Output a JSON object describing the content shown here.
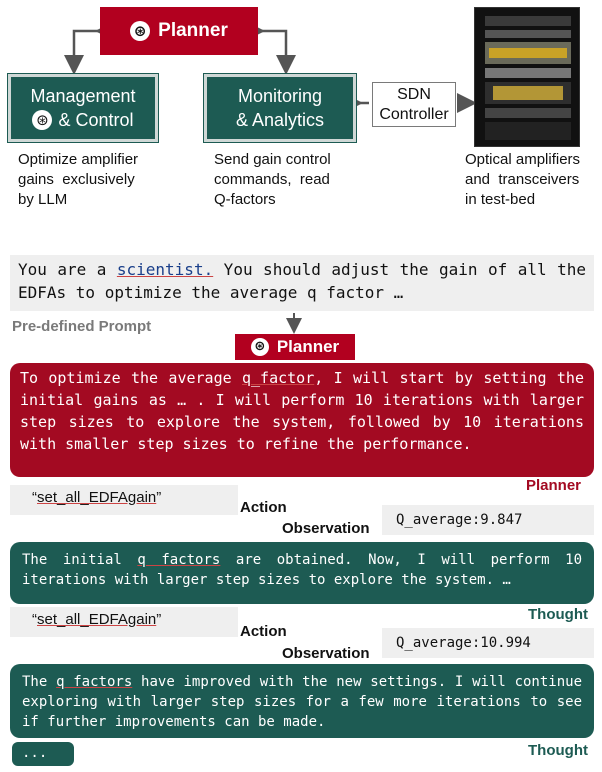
{
  "top": {
    "planner_label": "Planner",
    "management": [
      "Management",
      "& Control"
    ],
    "monitoring": [
      "Monitoring",
      "& Analytics"
    ],
    "sdn": [
      "SDN",
      "Controller"
    ],
    "desc_management": [
      "Optimize amplifier",
      "gains  exclusively",
      "by LLM"
    ],
    "desc_monitoring": [
      "Send gain control",
      "commands,  read",
      "Q-factors"
    ],
    "desc_optical": [
      "Optical amplifiers",
      "and  transceivers",
      "in test-bed"
    ]
  },
  "prompt": {
    "before": "You are a ",
    "link": "scientist.",
    "after": " You should adjust the gain of all the EDFAs to optimize the average q factor …",
    "caption": "Pre-defined Prompt"
  },
  "planner_mid_label": "Planner",
  "planner_text": {
    "a": "To optimize the average ",
    "b": "q_factor",
    "c": ", I will start by setting the initial gains as … . I will perform 10 iterations with larger step sizes to explore the system, followed by 10 iterations with smaller step sizes to refine the performance."
  },
  "planner_tag": "Planner",
  "step1": {
    "action_q1": "“",
    "action_name": "set_all_EDFAgain",
    "action_q2": "”",
    "action_label": "Action",
    "observation_label": "Observation",
    "observation_value": "Q_average:9.847",
    "thought_a": "The initial ",
    "thought_b": "q factors",
    "thought_c": " are obtained. Now, I will perform 10 iterations with larger step sizes to explore the system. …",
    "thought_label": "Thought"
  },
  "step2": {
    "action_q1": "“",
    "action_name": "set_all_EDFAgain",
    "action_q2": "”",
    "action_label": "Action",
    "observation_label": "Observation",
    "observation_value": "Q_average:10.994",
    "thought_a": "The ",
    "thought_b": "q factors",
    "thought_c": " have improved with the new settings. I will continue exploring with larger step sizes for a few more iterations to see if further improvements can be made.",
    "thought_label": "Thought"
  },
  "ellipsis": "...",
  "colors": {
    "red": "#b2001f",
    "green": "#1d5b53",
    "gray": "#efefef"
  }
}
